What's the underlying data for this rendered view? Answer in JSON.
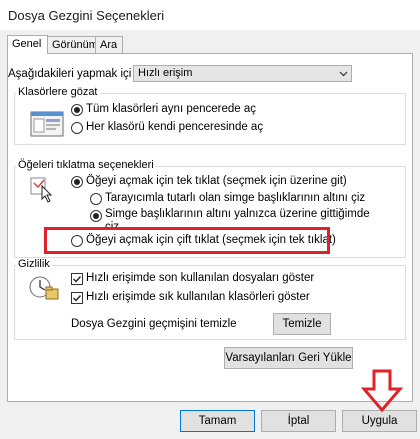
{
  "window": {
    "title": "Dosya Gezgini Seçenekleri"
  },
  "tabs": [
    {
      "label": "Genel"
    },
    {
      "label": "Görünüm"
    },
    {
      "label": "Ara"
    }
  ],
  "general": {
    "open_folders": {
      "label": "Aşağıdakileri yapmak içi",
      "value": "Hızlı erişim"
    },
    "browse_group": {
      "legend": "Klasörlere gözat",
      "same_window": "Tüm klasörleri aynı pencerede aç",
      "own_window": "Her klasörü kendi penceresinde aç"
    },
    "click_group": {
      "legend": "Öğeleri tıklatma seçenekleri",
      "single_click": "Öğeyi açmak için tek tıklat (seçmek için üzerine git)",
      "underline_browser": "Tarayıcımla tutarlı olan simge başlıklarının altını çiz",
      "underline_hover_line1": "Simge başlıklarının altını yalnızca üzerine gittiğimde",
      "underline_hover_line2": "çiz",
      "double_click": "Öğeyi açmak için çift tıklat (seçmek için tek tıklat)"
    },
    "privacy_group": {
      "legend": "Gizlilik",
      "recent_files": "Hızlı erişimde son kullanılan dosyaları göster",
      "frequent_folders": "Hızlı erişimde sık kullanılan klasörleri göster",
      "clear_history_label": "Dosya Gezgini geçmişini temizle",
      "clear_button": "Temizle"
    },
    "restore_defaults": "Varsayılanları Geri Yükle"
  },
  "footer": {
    "ok": "Tamam",
    "cancel": "İptal",
    "apply": "Uygula"
  },
  "annotation": {
    "highlight_color": "#e0202a"
  }
}
